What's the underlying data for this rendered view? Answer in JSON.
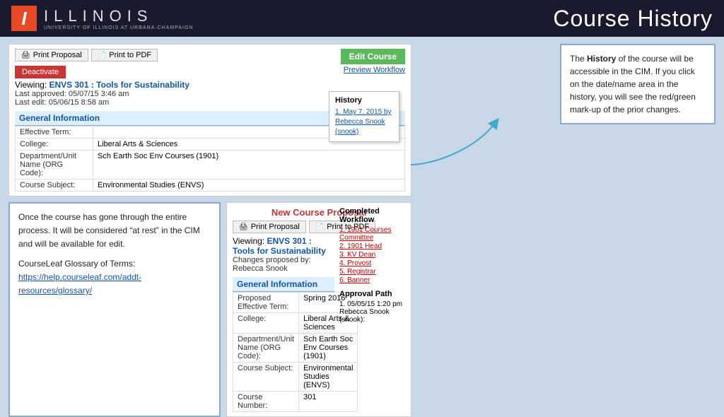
{
  "header": {
    "title": "Course History",
    "logo_i": "I",
    "logo_text": "ILLINOIS",
    "logo_subtitle": "UNIVERSITY OF ILLINOIS AT URBANA-CHAMPAIGN"
  },
  "top_panel": {
    "print_proposal_label": "Print Proposal",
    "print_pdf_label": "Print to PDF",
    "deactivate_label": "Deactivate",
    "viewing_prefix": "Viewing:",
    "course_name": "ENVS 301 : Tools for Sustainability",
    "last_approved": "Last approved: 05/07/15 3:46 am",
    "last_edit": "Last edit: 05/06/15 8:58 am",
    "edit_course_label": "Edit Course",
    "preview_workflow_label": "Preview Workflow",
    "history_title": "History",
    "history_entry": "1. May 7, 2015 by Rebecca Snook (snook)",
    "general_info_label": "General Information",
    "fields": [
      {
        "label": "Effective Term:",
        "value": ""
      },
      {
        "label": "College:",
        "value": "Liberal Arts & Sciences"
      },
      {
        "label": "Department/Unit Name (ORG Code):",
        "value": "Sch Earth Soc Env Courses (1901)"
      },
      {
        "label": "Course Subject:",
        "value": "Environmental Studies (ENVS)"
      }
    ]
  },
  "callout_top": {
    "text_normal1": "The ",
    "text_bold": "History",
    "text_normal2": " of the course will be accessible in the CIM. If you click on the date/name area in the history, you will see the red/green mark-up of the prior changes."
  },
  "callout_bottom": {
    "para1": "Once the course has gone through the entire process. It will be considered “at rest” in the CIM and will be available for edit.",
    "para2_prefix": "CourseLeaf Glossary of Terms: ",
    "link_text": "https://help.courseleaf.com/addt-resources/glossary/",
    "link_href": "https://help.courseleaf.com/addt-resources/glossary/"
  },
  "new_proposal": {
    "section_title": "New Course Proposal",
    "print_proposal_label": "Print Proposal",
    "print_pdf_label": "Print to PDF",
    "viewing_prefix": "Viewing:",
    "course_name": "ENVS 301 : Tools for Sustainability",
    "changes_proposed": "Changes proposed by: Rebecca Snook",
    "general_info_label": "General Information",
    "fields": [
      {
        "label": "Proposed Effective Term:",
        "value": "Spring 2016"
      },
      {
        "label": "College:",
        "value": "Liberal Arts & Sciences"
      },
      {
        "label": "Department/Unit Name (ORG Code):",
        "value": "Sch Earth Soc Env Courses (1901)"
      },
      {
        "label": "Course Subject:",
        "value": "Environmental Studies (ENVS)"
      },
      {
        "label": "Course Number:",
        "value": "301"
      }
    ],
    "completed_workflow_title": "Completed Workflow",
    "workflow_items": [
      "1. 1901 Courses Committee",
      "2. 1901 Head",
      "3. KV Dean",
      "4. Provost",
      "5. Registrar",
      "6. Banner"
    ],
    "approval_path_title": "Approval Path",
    "approval_path_items": [
      "1. 05/05/15 1:20 pm Rebecca Snook (snook):"
    ]
  }
}
